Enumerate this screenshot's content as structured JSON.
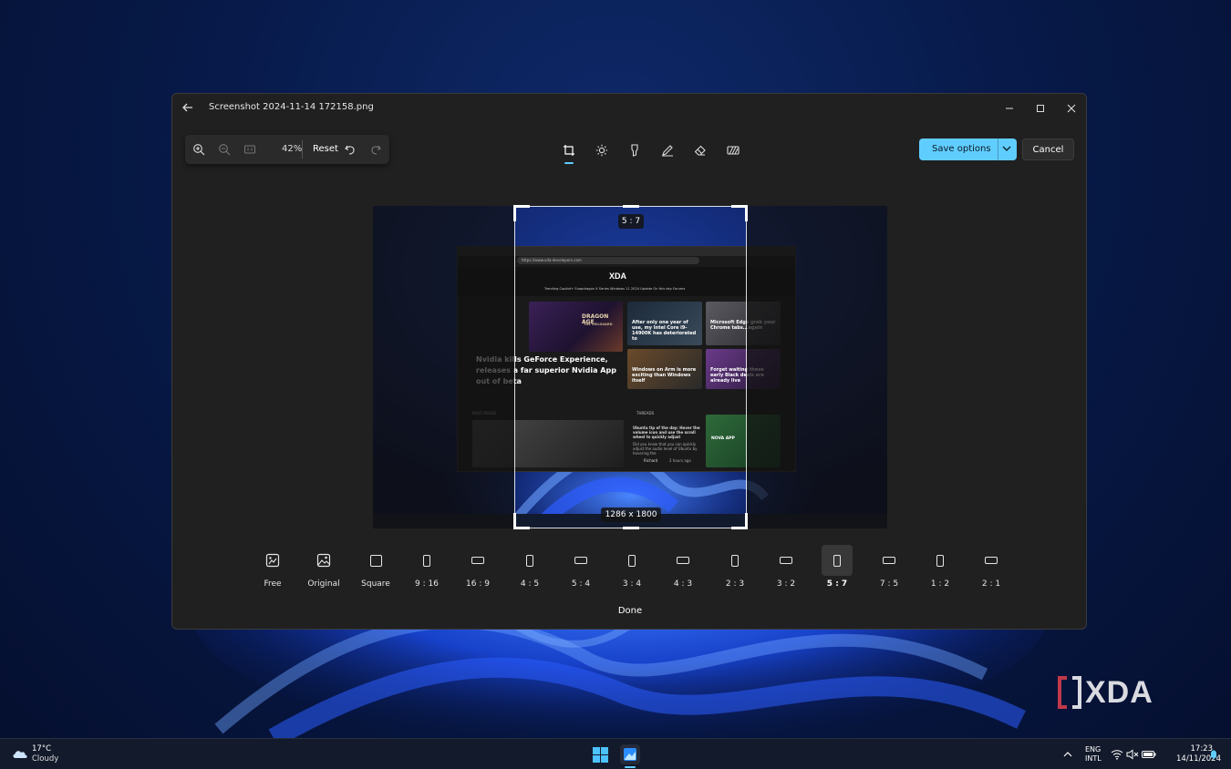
{
  "window": {
    "title": "Screenshot 2024-11-14 172158.png"
  },
  "zoom_toolbar": {
    "zoom_level": "42%",
    "reset_label": "Reset"
  },
  "actions": {
    "save_label": "Save options",
    "cancel_label": "Cancel"
  },
  "crop": {
    "ratio_label": "5 : 7",
    "size_label": "1286 x 1800"
  },
  "captured_page": {
    "url": "https://www.xda-developers.com",
    "logo_text": "XDA",
    "nav_items": "Trending    Copilot+    Snapdragon X Series    Windows 11 2024 Update    On this day    Forums",
    "headline": "Nvidia kills GeForce Experience, releases a far superior Nvidia App out of beta",
    "tile_1": "After only one year of use, my Intel Core i9-14900K has deteriorated to",
    "tile_2": "Microsoft Edge grab your Chrome tabs...again",
    "tile_3": "Windows on Arm is more exciting than Windows itself",
    "tile_4": "Forget waiting these early Black deals are already live",
    "must_reads": "MUST-READS",
    "threads": "THREADS",
    "thread_text": "Ubuntu tip of the day: Hover the volume icon and use the scroll wheel to quickly adjust",
    "thread_sub": "Did you know that you can quickly adjust the audio level of Ubuntu by hovering the",
    "thread_author": "Richard",
    "thread_time": "2 hours ago",
    "game_label": "DRAGON AGE",
    "game_sub": "THE VEILGUARD",
    "app_label": "NOVA APP"
  },
  "aspect_ratios": [
    {
      "label": "Free",
      "icon": "free-crop-icon"
    },
    {
      "label": "Original",
      "icon": "image-icon"
    },
    {
      "label": "Square",
      "icon": "square-icon"
    },
    {
      "label": "9 : 16",
      "icon": "portrait-ratio-icon"
    },
    {
      "label": "16 : 9",
      "icon": "landscape-ratio-icon"
    },
    {
      "label": "4 : 5",
      "icon": "portrait-ratio-icon"
    },
    {
      "label": "5 : 4",
      "icon": "landscape-ratio-icon"
    },
    {
      "label": "3 : 4",
      "icon": "portrait-ratio-icon"
    },
    {
      "label": "4 : 3",
      "icon": "landscape-ratio-icon"
    },
    {
      "label": "2 : 3",
      "icon": "portrait-ratio-icon"
    },
    {
      "label": "3 : 2",
      "icon": "landscape-ratio-icon"
    },
    {
      "label": "5 : 7",
      "icon": "portrait-ratio-icon",
      "selected": true
    },
    {
      "label": "7 : 5",
      "icon": "landscape-ratio-icon"
    },
    {
      "label": "1 : 2",
      "icon": "portrait-ratio-icon"
    },
    {
      "label": "2 : 1",
      "icon": "landscape-ratio-icon"
    }
  ],
  "done_label": "Done",
  "taskbar": {
    "weather_temp": "17°C",
    "weather_condition": "Cloudy",
    "lang_line1": "ENG",
    "lang_line2": "INTL",
    "time": "17:23",
    "date": "14/11/2024"
  },
  "colors": {
    "accent": "#60cdff",
    "window_bg": "#202020"
  }
}
